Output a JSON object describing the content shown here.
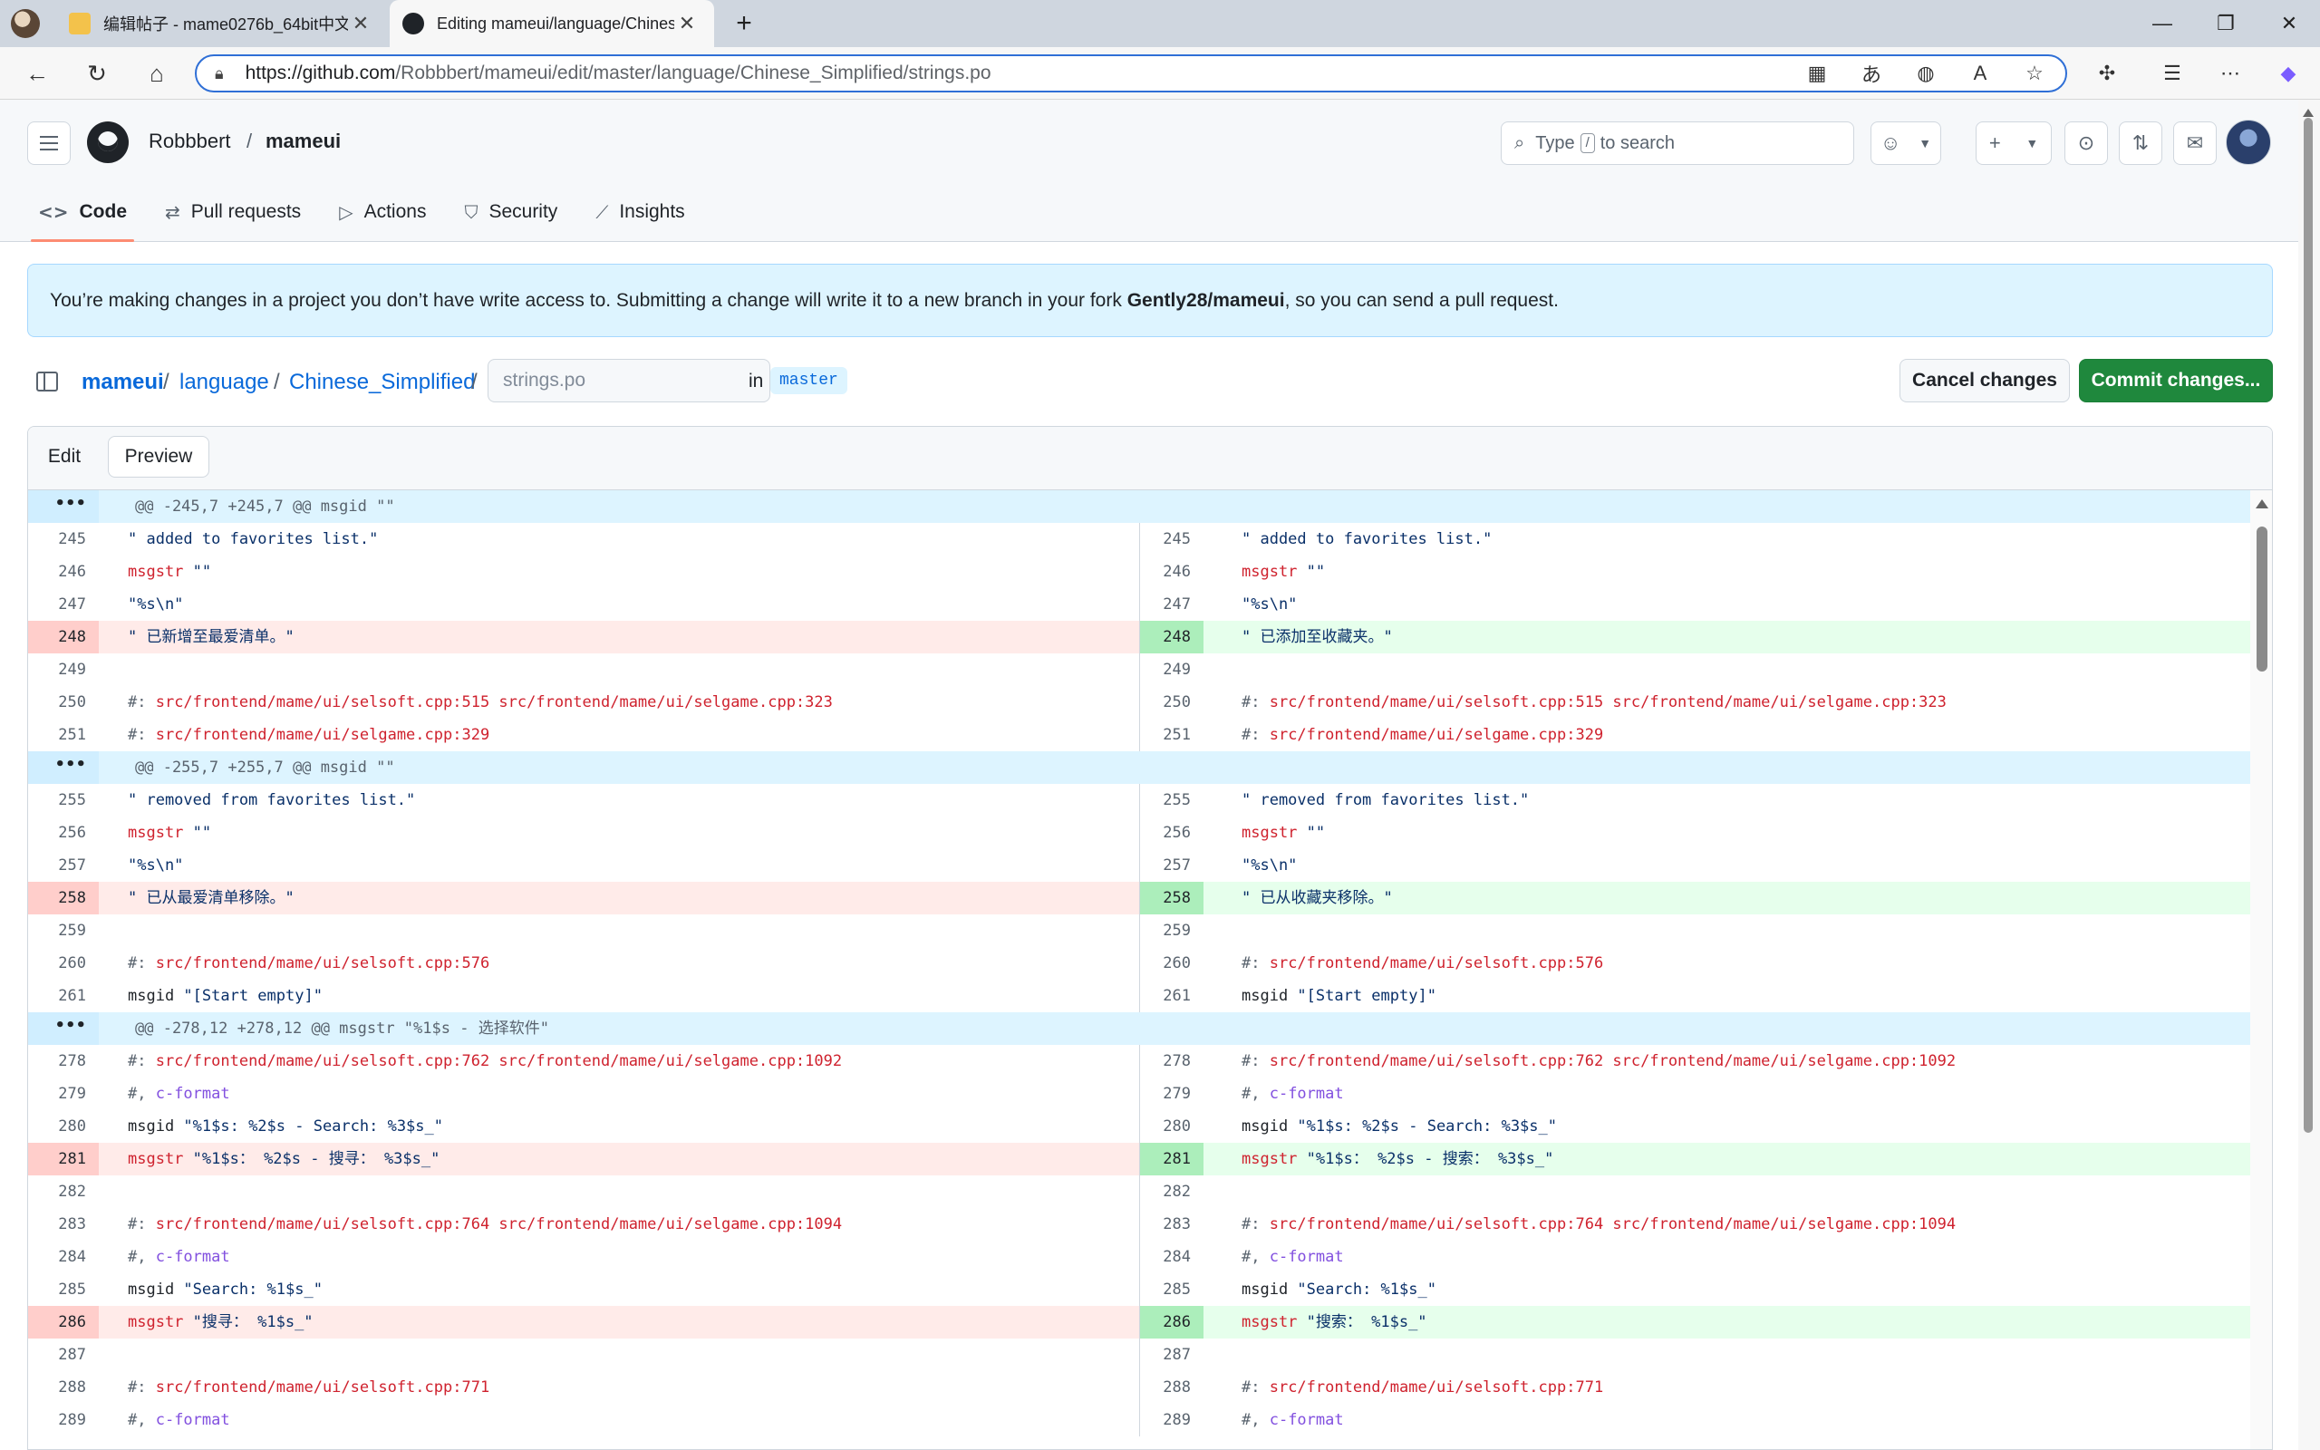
{
  "browser": {
    "tabs": [
      {
        "title": "编辑帖子 - mame0276b_64bit中文",
        "close": "✕"
      },
      {
        "title": "Editing mameui/language/Chines",
        "close": "✕"
      }
    ],
    "new_tab": "+",
    "window_controls": {
      "minimize": "—",
      "restore": "❐",
      "close": "✕"
    },
    "url_host": "https://github.com",
    "url_path": "/Robbbert/mameui/edit/master/language/Chinese_Simplified/strings.po",
    "icons": [
      "back-icon",
      "refresh-icon",
      "home-icon",
      "lock-icon",
      "app-available-icon",
      "read-aloud-translate-icon",
      "browser-essentials-icon",
      "read-aloud-icon",
      "favorite-star-icon",
      "extensions-icon",
      "favorites-icon",
      "more-icon",
      "copilot-icon"
    ]
  },
  "github": {
    "owner": "Robbbert",
    "separator": "/",
    "repo": "mameui",
    "search_prefix": "Type",
    "search_key": "/",
    "search_suffix": "to search",
    "nav": [
      {
        "label": "Code",
        "icon": "code-icon"
      },
      {
        "label": "Pull requests",
        "icon": "pull-request-icon"
      },
      {
        "label": "Actions",
        "icon": "actions-play-icon"
      },
      {
        "label": "Security",
        "icon": "shield-icon"
      },
      {
        "label": "Insights",
        "icon": "graph-icon"
      }
    ]
  },
  "notice": {
    "prefix": "You’re making changes in a project you don’t have write access to. Submitting a change will write it to a new branch in your fork ",
    "fork": "Gently28/mameui",
    "suffix": ", so you can send a pull request."
  },
  "editor": {
    "path": [
      "mameui",
      "language",
      "Chinese_Simplified"
    ],
    "sep": "/",
    "filename_placeholder": "strings.po",
    "in_label": "in",
    "branch": "master",
    "cancel_label": "Cancel changes",
    "commit_label": "Commit changes...",
    "tab_edit": "Edit",
    "tab_preview": "Preview"
  },
  "diff": {
    "hunk_dots": "•••",
    "rows": [
      {
        "kind": "hunk",
        "text": "@@ -245,7 +245,7 @@ msgid \"\""
      },
      {
        "kind": "ctx",
        "ln": "245",
        "rn": "245",
        "l": "\" added to favorites list.\"",
        "r": "\" added to favorites list.\"",
        "style": "str"
      },
      {
        "kind": "ctx",
        "ln": "246",
        "rn": "246",
        "l": "msgstr \"\"",
        "r": "msgstr \"\"",
        "style": "msgstr"
      },
      {
        "kind": "ctx",
        "ln": "247",
        "rn": "247",
        "l": "\"%s\\n\"",
        "r": "\"%s\\n\"",
        "style": "str"
      },
      {
        "kind": "chg",
        "ln": "248",
        "rn": "248",
        "l": "\" 已新增至最爱清单。\"",
        "r": "\" 已添加至收藏夹。\"",
        "style": "str"
      },
      {
        "kind": "ctx",
        "ln": "249",
        "rn": "249",
        "l": "",
        "r": "",
        "style": "str"
      },
      {
        "kind": "ctx",
        "ln": "250",
        "rn": "250",
        "l": "src/frontend/mame/ui/selsoft.cpp:515 src/frontend/mame/ui/selgame.cpp:323",
        "r": "src/frontend/mame/ui/selsoft.cpp:515 src/frontend/mame/ui/selgame.cpp:323",
        "style": "ref"
      },
      {
        "kind": "ctx",
        "ln": "251",
        "rn": "251",
        "l": "src/frontend/mame/ui/selgame.cpp:329",
        "r": "src/frontend/mame/ui/selgame.cpp:329",
        "style": "ref"
      },
      {
        "kind": "hunk",
        "text": "@@ -255,7 +255,7 @@ msgid \"\""
      },
      {
        "kind": "ctx",
        "ln": "255",
        "rn": "255",
        "l": "\" removed from favorites list.\"",
        "r": "\" removed from favorites list.\"",
        "style": "str"
      },
      {
        "kind": "ctx",
        "ln": "256",
        "rn": "256",
        "l": "msgstr \"\"",
        "r": "msgstr \"\"",
        "style": "msgstr"
      },
      {
        "kind": "ctx",
        "ln": "257",
        "rn": "257",
        "l": "\"%s\\n\"",
        "r": "\"%s\\n\"",
        "style": "str"
      },
      {
        "kind": "chg",
        "ln": "258",
        "rn": "258",
        "l": "\" 已从最爱清单移除。\"",
        "r": "\" 已从收藏夹移除。\"",
        "style": "str"
      },
      {
        "kind": "ctx",
        "ln": "259",
        "rn": "259",
        "l": "",
        "r": "",
        "style": "str"
      },
      {
        "kind": "ctx",
        "ln": "260",
        "rn": "260",
        "l": "src/frontend/mame/ui/selsoft.cpp:576",
        "r": "src/frontend/mame/ui/selsoft.cpp:576",
        "style": "ref"
      },
      {
        "kind": "ctx",
        "ln": "261",
        "rn": "261",
        "l": "msgid \"[Start empty]\"",
        "r": "msgid \"[Start empty]\"",
        "style": "msgid"
      },
      {
        "kind": "hunk",
        "text": "@@ -278,12 +278,12 @@ msgstr \"%1$s - 选择软件\""
      },
      {
        "kind": "ctx",
        "ln": "278",
        "rn": "278",
        "l": "src/frontend/mame/ui/selsoft.cpp:762 src/frontend/mame/ui/selgame.cpp:1092",
        "r": "src/frontend/mame/ui/selsoft.cpp:762 src/frontend/mame/ui/selgame.cpp:1092",
        "style": "ref"
      },
      {
        "kind": "ctx",
        "ln": "279",
        "rn": "279",
        "l": "c-format",
        "r": "c-format",
        "style": "flag"
      },
      {
        "kind": "ctx",
        "ln": "280",
        "rn": "280",
        "l": "msgid \"%1$s: %2$s - Search: %3$s_\"",
        "r": "msgid \"%1$s: %2$s - Search: %3$s_\"",
        "style": "msgid"
      },
      {
        "kind": "chg",
        "ln": "281",
        "rn": "281",
        "l": "msgstr \"%1$s： %2$s - 搜寻： %3$s_\"",
        "r": "msgstr \"%1$s： %2$s - 搜索： %3$s_\"",
        "style": "msgstr"
      },
      {
        "kind": "ctx",
        "ln": "282",
        "rn": "282",
        "l": "",
        "r": "",
        "style": "str"
      },
      {
        "kind": "ctx",
        "ln": "283",
        "rn": "283",
        "l": "src/frontend/mame/ui/selsoft.cpp:764 src/frontend/mame/ui/selgame.cpp:1094",
        "r": "src/frontend/mame/ui/selsoft.cpp:764 src/frontend/mame/ui/selgame.cpp:1094",
        "style": "ref"
      },
      {
        "kind": "ctx",
        "ln": "284",
        "rn": "284",
        "l": "c-format",
        "r": "c-format",
        "style": "flag"
      },
      {
        "kind": "ctx",
        "ln": "285",
        "rn": "285",
        "l": "msgid \"Search: %1$s_\"",
        "r": "msgid \"Search: %1$s_\"",
        "style": "msgid"
      },
      {
        "kind": "chg",
        "ln": "286",
        "rn": "286",
        "l": "msgstr \"搜寻： %1$s_\"",
        "r": "msgstr \"搜索： %1$s_\"",
        "style": "msgstr"
      },
      {
        "kind": "ctx",
        "ln": "287",
        "rn": "287",
        "l": "",
        "r": "",
        "style": "str"
      },
      {
        "kind": "ctx",
        "ln": "288",
        "rn": "288",
        "l": "src/frontend/mame/ui/selsoft.cpp:771",
        "r": "src/frontend/mame/ui/selsoft.cpp:771",
        "style": "ref"
      },
      {
        "kind": "ctx",
        "ln": "289",
        "rn": "289",
        "l": "c-format",
        "r": "c-format",
        "style": "flag"
      }
    ]
  },
  "colors": {
    "accent": "#0969da",
    "commit_green": "#1f883d",
    "del_bg": "#ffebe9",
    "add_bg": "#e6ffec",
    "hunk_bg": "#ddf4ff"
  }
}
